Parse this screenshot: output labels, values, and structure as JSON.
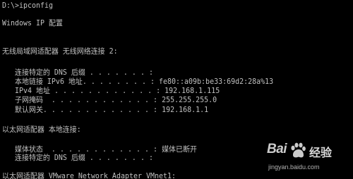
{
  "console": {
    "text_color": "#c0c0c0",
    "background": "#000000",
    "lines": [
      "D:\\>ipconfig",
      "Windows IP 配置",
      "无线局域网适配器 无线网络连接 2:",
      "   连接特定的 DNS 后缀 . . . . . . . :",
      "   本地链接 IPv6 地址. . . . . . . . : fe80::a09b:be33:69d2:28a%13",
      "   IPv4 地址 . . . . . . . . . . . . : 192.168.1.115",
      "   子网掩码  . . . . . . . . . . . . : 255.255.255.0",
      "   默认网关. . . . . . . . . . . . . : 192.168.1.1",
      "以太网适配器 本地连接:",
      "   媒体状态  . . . . . . . . . . . . : 媒体已断开",
      "   连接特定的 DNS 后缀 . . . . . . . :",
      "以太网适配器 VMware Network Adapter VMnet1:"
    ]
  },
  "watermark": {
    "logo": "Bai",
    "logo_icon": "paw-icon",
    "name": "经验",
    "url": "jingyan.baidu.com"
  }
}
